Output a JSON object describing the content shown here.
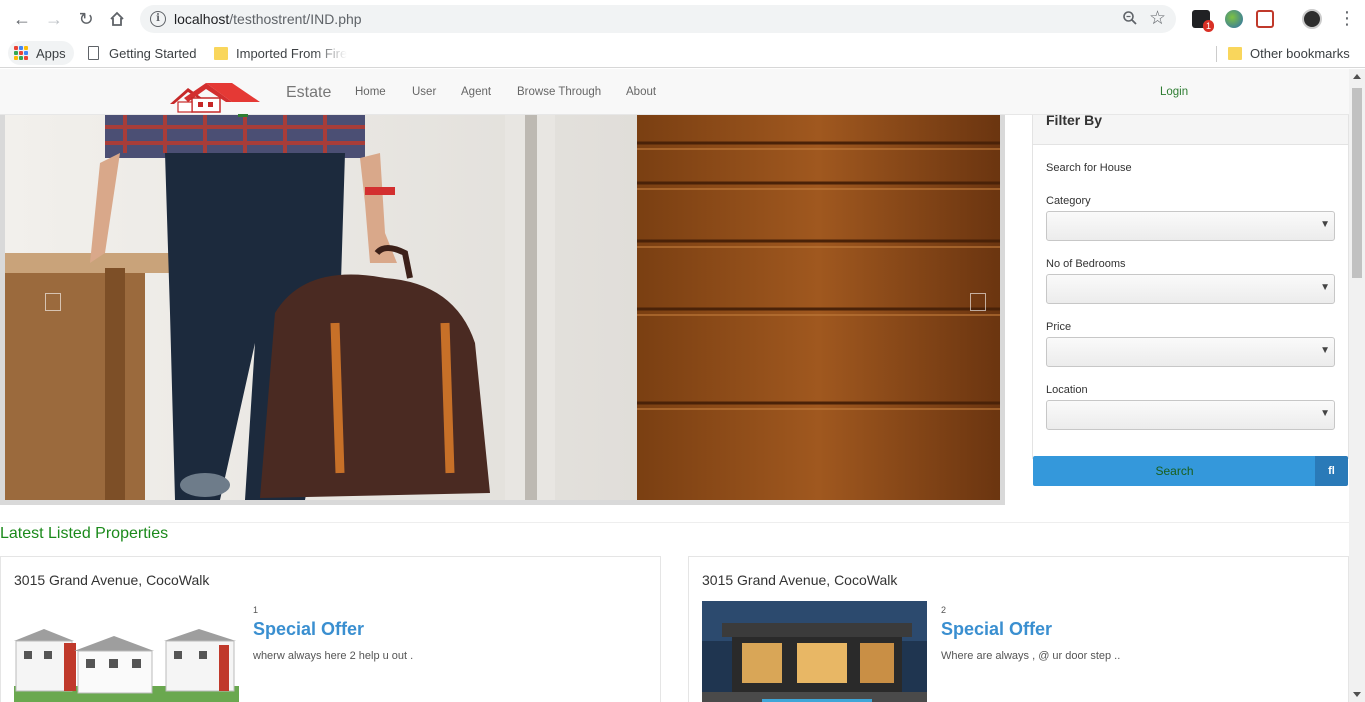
{
  "browser": {
    "url_host": "localhost",
    "url_path": "/testhostrent/IND.php",
    "extension_badge": "1",
    "bookmarks": {
      "apps": "Apps",
      "getting_started": "Getting Started",
      "imported": "Imported From Fire",
      "other": "Other bookmarks"
    }
  },
  "site": {
    "brand": "Estate",
    "nav": [
      "Home",
      "User",
      "Agent",
      "Browse Through",
      "About"
    ],
    "login": "Login"
  },
  "filter": {
    "heading": "Filter By",
    "subheading": "Search for House",
    "fields": [
      {
        "label": "Category",
        "value": ""
      },
      {
        "label": "No of Bedrooms",
        "value": ""
      },
      {
        "label": "Price",
        "value": ""
      },
      {
        "label": "Location",
        "value": ""
      }
    ],
    "search_label": "Search",
    "search_addon": "fl"
  },
  "listings": {
    "heading": "Latest Listed Properties",
    "items": [
      {
        "address": "3015 Grand Avenue, CocoWalk",
        "number": "1",
        "title": "Special Offer",
        "description": "wherw always here 2 help u out ."
      },
      {
        "address": "3015 Grand Avenue, CocoWalk",
        "number": "2",
        "title": "Special Offer",
        "description": "Where are always , @ ur door step .."
      }
    ]
  },
  "colors": {
    "accent_green": "#1b8a1b",
    "search_blue": "#3498db",
    "offer_blue": "#3a8fd0"
  }
}
